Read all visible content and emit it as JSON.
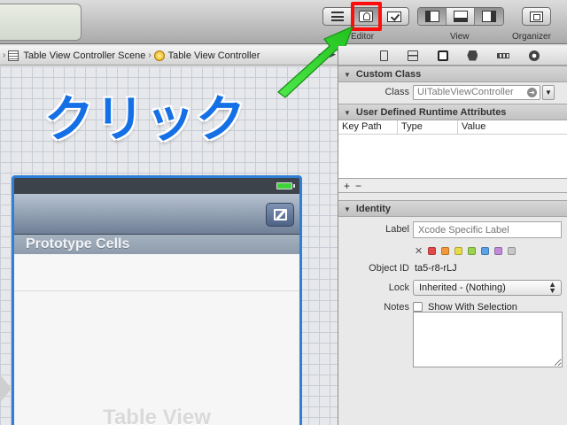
{
  "toolbar": {
    "editor_label": "Editor",
    "view_label": "View",
    "organizer_label": "Organizer",
    "editor_buttons": [
      {
        "icon": "standard-editor-icon"
      },
      {
        "icon": "assistant-editor-icon",
        "highlighted": true
      },
      {
        "icon": "version-editor-icon"
      }
    ],
    "view_buttons": [
      {
        "icon": "navigator-pane-icon"
      },
      {
        "icon": "debug-area-icon"
      },
      {
        "icon": "utilities-pane-icon"
      }
    ],
    "highlight_color": "#ff0d0d"
  },
  "jumpbar": {
    "items": [
      "Table View Controller Scene",
      "Table View Controller"
    ],
    "separator": "›"
  },
  "canvas": {
    "annotation": "クリック",
    "annotation_color": "#1570e6",
    "arrow_color": "#2fd62a",
    "section_header": "Prototype Cells",
    "table_view_label": "Table View"
  },
  "inspector": {
    "custom_class": {
      "header": "Custom Class",
      "class_label": "Class",
      "class_placeholder": "UITableViewController"
    },
    "runtime_attrs": {
      "header": "User Defined Runtime Attributes",
      "columns": [
        "Key Path",
        "Type",
        "Value"
      ],
      "add": "+",
      "remove": "−"
    },
    "identity": {
      "header": "Identity",
      "label_label": "Label",
      "label_placeholder": "Xcode Specific Label",
      "clear_mark": "✕",
      "label_colors": [
        "#e24a4a",
        "#f29a3b",
        "#e8d94a",
        "#9ad34e",
        "#5aa3e8",
        "#c08ad8",
        "#c7c7c7"
      ],
      "object_id_label": "Object ID",
      "object_id_value": "ta5-r8-rLJ",
      "lock_label": "Lock",
      "lock_value": "Inherited - (Nothing)",
      "notes_label": "Notes",
      "notes_checkbox": "Show With Selection"
    }
  }
}
